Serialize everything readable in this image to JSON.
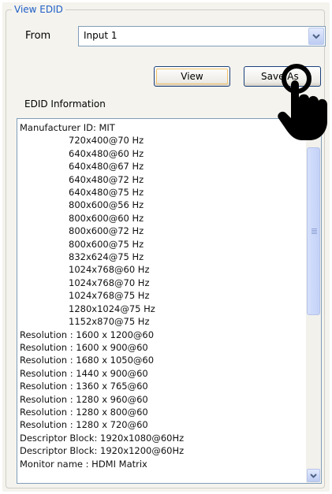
{
  "group": {
    "title": "View EDID"
  },
  "source": {
    "label": "From",
    "selected": "Input 1"
  },
  "buttons": {
    "view": "View",
    "save_as": "Save As"
  },
  "info": {
    "label": "EDID Information",
    "lines": [
      {
        "text": "Manufacturer ID: MIT",
        "indent": false
      },
      {
        "text": "720x400@70 Hz",
        "indent": true
      },
      {
        "text": "640x480@60 Hz",
        "indent": true
      },
      {
        "text": "640x480@67 Hz",
        "indent": true
      },
      {
        "text": "640x480@72 Hz",
        "indent": true
      },
      {
        "text": "640x480@75 Hz",
        "indent": true
      },
      {
        "text": "800x600@56 Hz",
        "indent": true
      },
      {
        "text": "800x600@60 Hz",
        "indent": true
      },
      {
        "text": "800x600@72 Hz",
        "indent": true
      },
      {
        "text": "800x600@75 Hz",
        "indent": true
      },
      {
        "text": "832x624@75 Hz",
        "indent": true
      },
      {
        "text": "1024x768@60 Hz",
        "indent": true
      },
      {
        "text": "1024x768@70 Hz",
        "indent": true
      },
      {
        "text": "1024x768@75 Hz",
        "indent": true
      },
      {
        "text": "1280x1024@75 Hz",
        "indent": true
      },
      {
        "text": "1152x870@75 Hz",
        "indent": true
      },
      {
        "text": "Resolution : 1600 x 1200@60",
        "indent": false
      },
      {
        "text": "Resolution : 1600 x 900@60",
        "indent": false
      },
      {
        "text": "Resolution : 1680 x 1050@60",
        "indent": false
      },
      {
        "text": "Resolution : 1440 x 900@60",
        "indent": false
      },
      {
        "text": "Resolution : 1360 x 765@60",
        "indent": false
      },
      {
        "text": "Resolution : 1280 x 960@60",
        "indent": false
      },
      {
        "text": "Resolution : 1280 x 800@60",
        "indent": false
      },
      {
        "text": "Resolution : 1280 x 720@60",
        "indent": false
      },
      {
        "text": "Descriptor Block: 1920x1080@60Hz",
        "indent": false
      },
      {
        "text": "Descriptor Block: 1920x1200@60Hz",
        "indent": false
      },
      {
        "text": "Monitor name : HDMI Matrix",
        "indent": false
      }
    ]
  },
  "icons": {
    "dropdown": "chevron-down-icon",
    "scroll_down": "chevron-down-icon",
    "pointer": "hand-pointer-icon"
  },
  "colors": {
    "group_title": "#1f5fc7",
    "border": "#7f9db9",
    "panel": "#f4f3ee"
  }
}
